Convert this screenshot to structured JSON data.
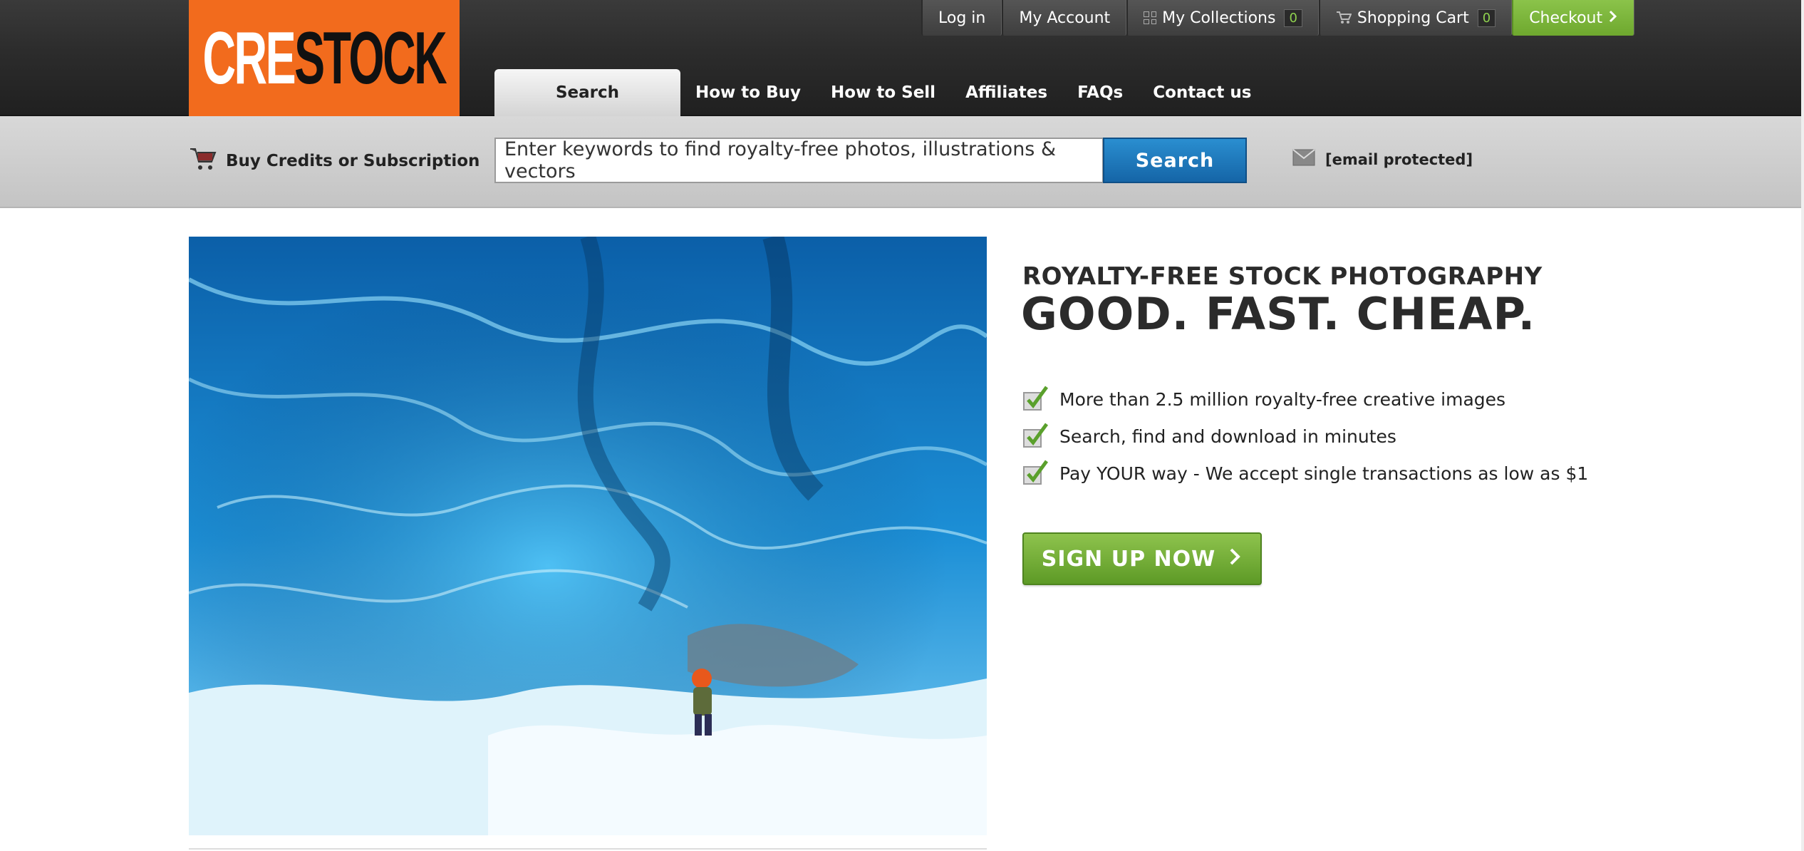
{
  "logo": {
    "part1": "CRE",
    "part2": "STOCK"
  },
  "topbar": {
    "login": "Log in",
    "account": "My Account",
    "collections": "My Collections",
    "collections_count": "0",
    "cart": "Shopping Cart",
    "cart_count": "0",
    "checkout": "Checkout"
  },
  "nav": {
    "items": [
      "Search",
      "How to Buy",
      "How to Sell",
      "Affiliates",
      "FAQs",
      "Contact us"
    ]
  },
  "searchbar": {
    "buy_credits": "Buy Credits or Subscription",
    "placeholder": "Enter keywords to find royalty-free photos, illustrations & vectors",
    "button": "Search",
    "email": "[email protected]"
  },
  "hero": {
    "tagline_small": "ROYALTY-FREE STOCK PHOTOGRAPHY",
    "tagline_big": "GOOD. FAST. CHEAP.",
    "features": [
      "More than 2.5 million royalty-free creative images",
      "Search, find and download in minutes",
      "Pay YOUR way - We accept single transactions as low as $1"
    ],
    "signup": "SIGN UP NOW"
  },
  "colors": {
    "brand_orange": "#f26b1d",
    "header_dark": "#2c2c2c",
    "accent_green": "#6ea82e",
    "search_blue": "#1a76bb"
  }
}
